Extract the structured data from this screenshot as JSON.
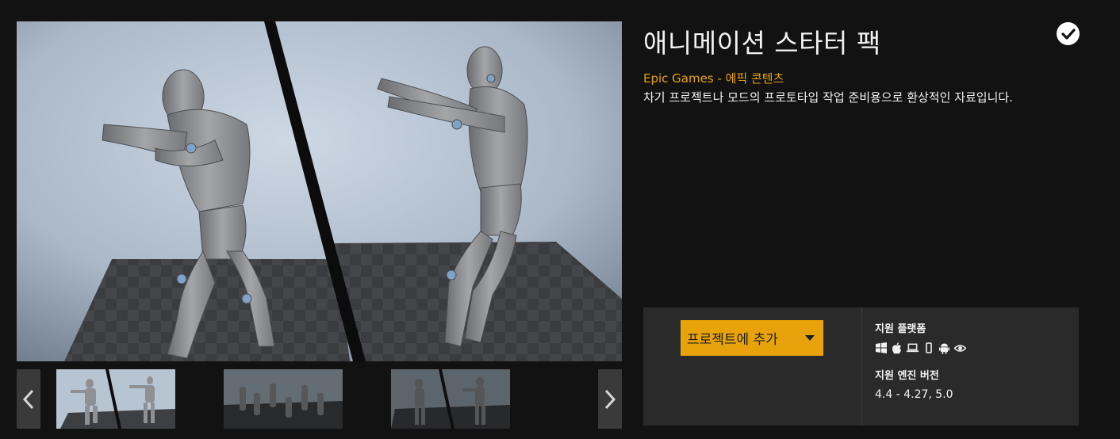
{
  "product": {
    "title": "애니메이션 스타터 팩",
    "seller": "Epic Games - 에픽 콘텐츠",
    "description": "차기 프로젝트나 모드의 프로토타입 작업 준비용으로 환상적인 자료입니다.",
    "owned_icon": "checkmark-circle-icon"
  },
  "gallery": {
    "main_image": "mannequin-pair-render",
    "prev_icon": "chevron-left-icon",
    "next_icon": "chevron-right-icon",
    "thumbnails": [
      {
        "name": "mannequin-pair-thumbnail",
        "active": true
      },
      {
        "name": "mannequin-group-thumbnail",
        "active": false
      },
      {
        "name": "mannequin-pair-dark-thumbnail",
        "active": false
      }
    ]
  },
  "purchase": {
    "add_to_project_label": "프로젝트에 추가",
    "dropdown_icon": "caret-down-icon"
  },
  "info": {
    "platforms_heading": "지원 플랫폼",
    "platforms": [
      "windows-icon",
      "apple-icon",
      "laptop-icon",
      "mobile-icon",
      "android-icon",
      "vr-eye-icon"
    ],
    "engine_heading": "지원 엔진 버전",
    "engine_versions": "4.4 - 4.27, 5.0"
  },
  "colors": {
    "background": "#121212",
    "accent": "#e8a30c",
    "panel": "#2a2a2a"
  }
}
